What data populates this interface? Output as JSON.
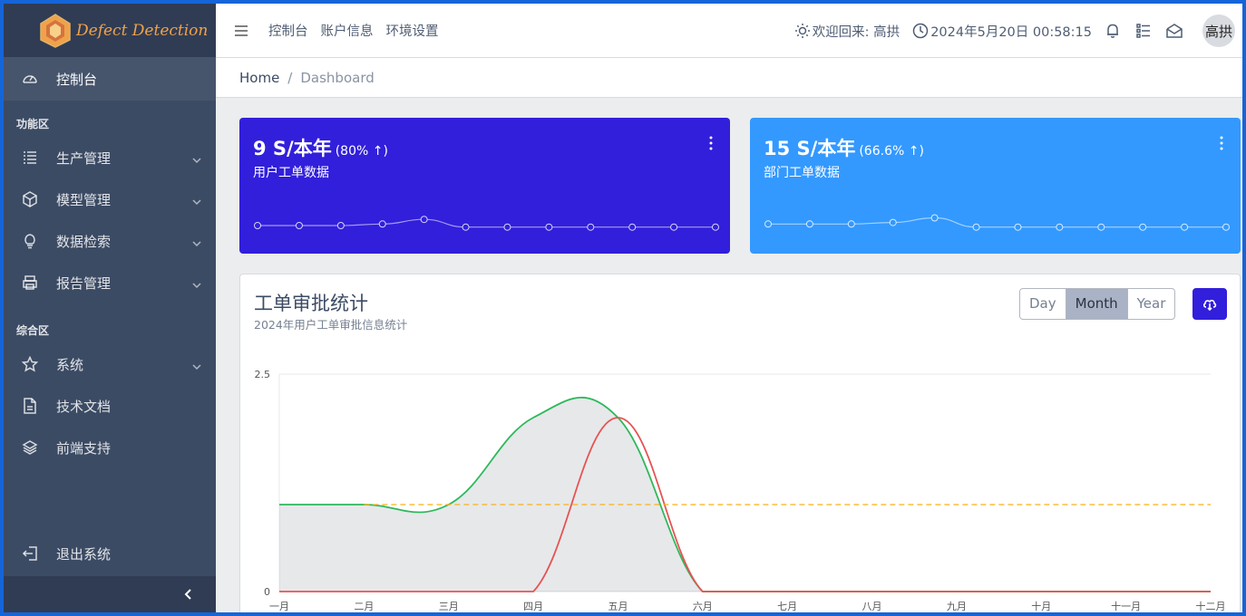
{
  "brand": {
    "name": "Defect Detection"
  },
  "sidebar": {
    "dashboard": "控制台",
    "section1": "功能区",
    "items1": [
      {
        "label": "生产管理",
        "icon": "list-icon"
      },
      {
        "label": "模型管理",
        "icon": "cube-icon"
      },
      {
        "label": "数据检索",
        "icon": "lightbulb-icon"
      },
      {
        "label": "报告管理",
        "icon": "printer-icon"
      }
    ],
    "section2": "综合区",
    "items2": [
      {
        "label": "系统",
        "icon": "star-icon"
      },
      {
        "label": "技术文档",
        "icon": "document-icon"
      },
      {
        "label": "前端支持",
        "icon": "layers-icon"
      }
    ],
    "logout": "退出系统"
  },
  "header": {
    "nav": [
      "控制台",
      "账户信息",
      "环境设置"
    ],
    "welcome": "欢迎回来: 高拱",
    "datetime": "2024年5月20日 00:58:15",
    "avatar": "高拱"
  },
  "breadcrumb": {
    "home": "Home",
    "current": "Dashboard"
  },
  "cards": [
    {
      "value": "9 S/本年",
      "pct": "(80% ↑)",
      "label": "用户工单数据",
      "color": "#321fdb",
      "spark": [
        1.0,
        1.0,
        1.0,
        1.1,
        1.4,
        0.9,
        0.9,
        0.9,
        0.9,
        0.9,
        0.9,
        0.9
      ]
    },
    {
      "value": "15 S/本年",
      "pct": "(66.6% ↑)",
      "label": "部门工单数据",
      "color": "#3399ff",
      "spark": [
        1.1,
        1.1,
        1.1,
        1.2,
        1.5,
        0.9,
        0.9,
        0.9,
        0.9,
        0.9,
        0.9,
        0.9
      ]
    }
  ],
  "chart_section": {
    "title": "工单审批统计",
    "subtitle": "2024年用户工单审批信息统计",
    "buttons": [
      "Day",
      "Month",
      "Year"
    ],
    "selected": "Month"
  },
  "chart_data": {
    "type": "line",
    "categories": [
      "一月",
      "二月",
      "三月",
      "四月",
      "五月",
      "六月",
      "七月",
      "八月",
      "九月",
      "十月",
      "十一月",
      "十二月"
    ],
    "series": [
      {
        "color": "#2eb85c",
        "fill": true,
        "values": [
          1,
          1,
          1,
          2,
          2,
          0,
          0,
          0,
          0,
          0,
          0,
          0
        ]
      },
      {
        "color": "#e55353",
        "fill": false,
        "values": [
          0,
          0,
          0,
          0,
          2,
          0,
          0,
          0,
          0,
          0,
          0,
          0
        ]
      },
      {
        "color": "#f9b115",
        "dashed": true,
        "values": [
          1,
          1,
          1,
          1,
          1,
          1,
          1,
          1,
          1,
          1,
          1,
          1
        ]
      }
    ],
    "ylim": [
      0,
      2.5
    ],
    "yticks": [
      "0",
      "2.5"
    ]
  }
}
